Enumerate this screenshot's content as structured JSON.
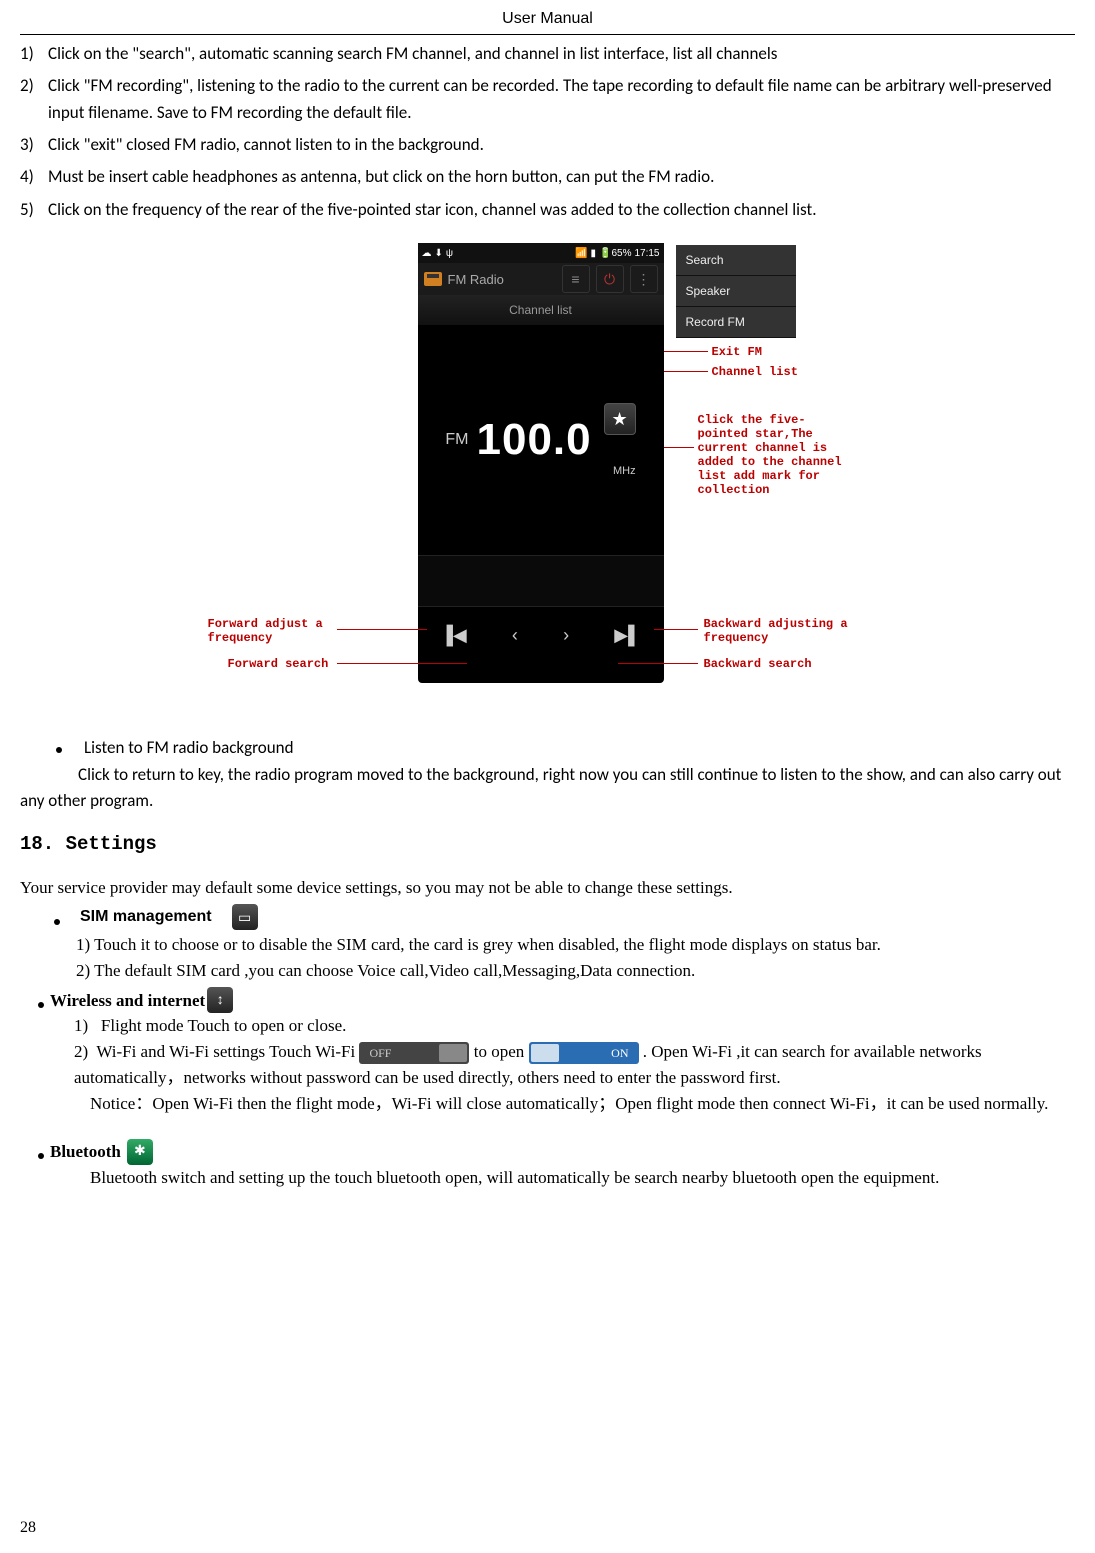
{
  "header": {
    "title": "User    Manual"
  },
  "list": {
    "items": [
      {
        "n": "1)",
        "t": "Click on the \"search\", automatic scanning search FM channel, and channel in list interface, list all channels"
      },
      {
        "n": "2)",
        "t": "Click \"FM recording\", listening to the radio to the current can be recorded. The tape recording to default file name can be arbitrary well-preserved input filename. Save to FM recording the default file."
      },
      {
        "n": "3)",
        "t": "Click \"exit\" closed FM radio, cannot listen to in the background."
      },
      {
        "n": "4)",
        "t": "Must be insert cable headphones as antenna, but click on the horn button, can put the FM radio."
      },
      {
        "n": "5)",
        "t": "Click on the frequency of the rear of the five-pointed star icon, channel was added to the collection channel list."
      }
    ]
  },
  "phone": {
    "status_time": "17:15",
    "status_batt": "65%",
    "app_title": "FM Radio",
    "channel_list": "Channel list",
    "fm": "FM",
    "freq": "100.0",
    "mhz": "MHz",
    "menu": {
      "search": "Search",
      "speaker": "Speaker",
      "record": "Record FM"
    },
    "controls": {
      "prev": "◄◄",
      "back": "‹",
      "fwd": "›",
      "next": "►►"
    }
  },
  "annotations": {
    "exit": "Exit FM",
    "chlist": "Channel list",
    "star": "Click the five-\npointed star,The\ncurrent channel is\nadded to the channel\nlist add mark for\ncollection",
    "fwd_adj": "Forward adjust a\nfrequency",
    "fwd_search": "Forward search",
    "bwd_adj": "Backward adjusting a\nfrequency",
    "bwd_search": "Backward search"
  },
  "bg_bullet": {
    "title": "Listen to FM radio background",
    "body": "Click to return to key, the radio program moved to the background, right now you can still continue to listen to the show, and can also carry out any other program."
  },
  "h18": "18. Settings",
  "settings_intro": "Your service provider may default some device settings, so you may not be able to change these settings.",
  "sim": {
    "title": "SIM management",
    "l1": "1) Touch it to choose or to disable the SIM card, the card is grey when disabled, the flight mode displays on status bar.",
    "l2": "2) The default SIM card ,you can choose Voice call,Video call,Messaging,Data connection."
  },
  "wireless": {
    "title": "Wireless and internet",
    "flight_n": "1)",
    "flight": "Flight mode      Touch to open or close.",
    "wifi_n": "2)",
    "wifi_pre": "Wi-Fi and Wi-Fi settings        Touch Wi-Fi ",
    "wifi_mid": " to open ",
    "wifi_post": ". Open Wi-Fi ,it can search for available networks automatically，networks without password can be used directly, others need to enter the password first.",
    "off_label": "OFF",
    "on_label": "ON",
    "notice": "Notice：Open Wi-Fi then the flight mode，Wi-Fi will close automatically；Open flight mode then connect Wi-Fi，it can be used normally."
  },
  "bt": {
    "title": "Bluetooth",
    "body": "Bluetooth switch and setting up the touch bluetooth open, will automatically be search nearby bluetooth open the equipment."
  },
  "pagenum": "28"
}
